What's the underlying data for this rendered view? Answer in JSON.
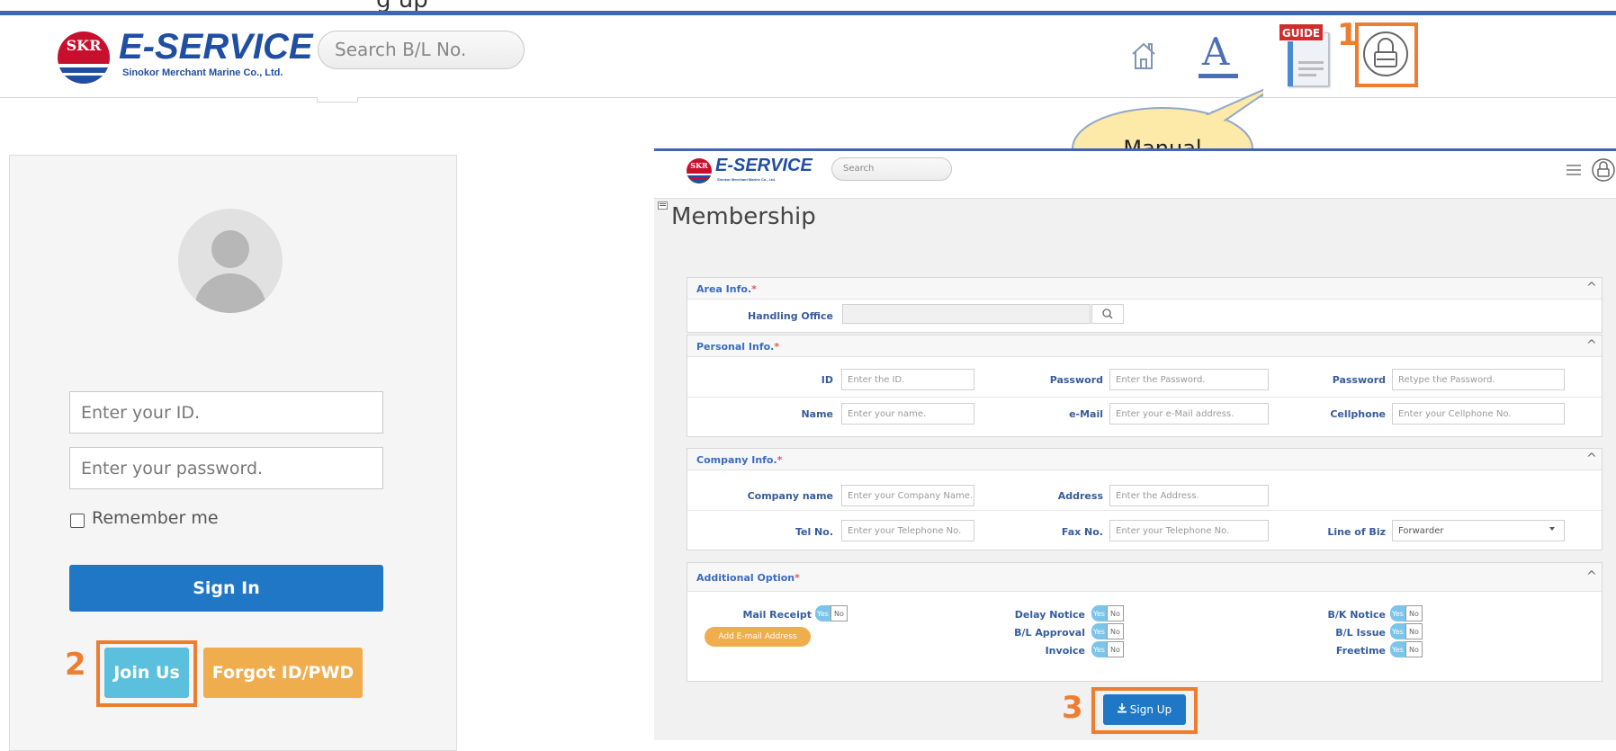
{
  "header": {
    "cut_text": "g up",
    "logo": {
      "mark": "SKR",
      "title": "E-SERVICE",
      "subtitle": "Sinokor Merchant Marine Co., Ltd."
    },
    "search_placeholder": "Search B/L No.",
    "font_icon_letter": "A",
    "guide_label": "GUIDE",
    "icons": [
      "home-icon",
      "font-size-icon",
      "guide-manual-icon",
      "lock-icon"
    ]
  },
  "callouts": {
    "manual_bubble": "Manual",
    "numbers": [
      "1",
      "2",
      "3"
    ]
  },
  "login": {
    "id_placeholder": "Enter your ID.",
    "password_placeholder": "Enter your password.",
    "remember_label": "Remember me",
    "sign_in": "Sign In",
    "join_us": "Join Us",
    "forgot": "Forgot ID/PWD"
  },
  "membership": {
    "logo_title": "E-SERVICE",
    "logo_sub": "Sinokor Merchant Marine Co., Ltd.",
    "search_placeholder": "Search",
    "page_title": "Membership",
    "area_info": {
      "title": "Area Info.",
      "handling_office_label": "Handling Office"
    },
    "personal_info": {
      "title": "Personal Info.",
      "id_label": "ID",
      "id_placeholder": "Enter the ID.",
      "password_label": "Password",
      "password_placeholder": "Enter the Password.",
      "password2_label": "Password",
      "password2_placeholder": "Retype the Password.",
      "name_label": "Name",
      "name_placeholder": "Enter your name.",
      "email_label": "e-Mail",
      "email_placeholder": "Enter your e-Mail address.",
      "cellphone_label": "Cellphone",
      "cellphone_placeholder": "Enter your Cellphone No."
    },
    "company_info": {
      "title": "Company Info.",
      "company_label": "Company name",
      "company_placeholder": "Enter your Company Name.",
      "address_label": "Address",
      "address_placeholder": "Enter the Address.",
      "tel_label": "Tel No.",
      "tel_placeholder": "Enter your Telephone No.",
      "fax_label": "Fax No.",
      "fax_placeholder": "Enter your Telephone No.",
      "biz_label": "Line of Biz",
      "biz_value": "Forwarder"
    },
    "additional_option": {
      "title": "Additional Option",
      "mail_receipt": "Mail Receipt",
      "add_email": "Add E-mail Address",
      "delay_notice": "Delay Notice",
      "bl_approval": "B/L Approval",
      "invoice": "Invoice",
      "bk_notice": "B/K Notice",
      "bl_issue": "B/L Issue",
      "freetime": "Freetime",
      "yes": "Yes",
      "no": "No"
    },
    "sign_up": "Sign Up",
    "required_mark": "*",
    "collapse_glyph": "^"
  }
}
